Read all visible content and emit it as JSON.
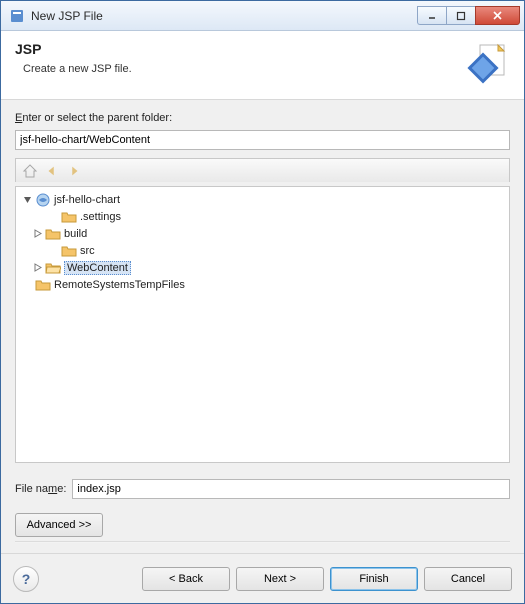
{
  "titlebar": {
    "title": "New JSP File"
  },
  "header": {
    "title": "JSP",
    "subtitle": "Create a new JSP file."
  },
  "body": {
    "parent_label_pre": "E",
    "parent_label_rest": "nter or select the parent folder:",
    "parent_value": "jsf-hello-chart/WebContent",
    "tree": {
      "root": "jsf-hello-chart",
      "children": [
        {
          "label": ".settings",
          "expandable": false
        },
        {
          "label": "build",
          "expandable": true
        },
        {
          "label": "src",
          "expandable": false
        },
        {
          "label": "WebContent",
          "expandable": true,
          "selected": true,
          "open": true
        }
      ],
      "sibling": "RemoteSystemsTempFiles"
    },
    "filename_label_pre": "File na",
    "filename_label_ul": "m",
    "filename_label_post": "e:",
    "filename_value": "index.jsp",
    "advanced_label": "Advanced >>"
  },
  "footer": {
    "back": "< Back",
    "next": "Next >",
    "finish": "Finish",
    "cancel": "Cancel"
  }
}
